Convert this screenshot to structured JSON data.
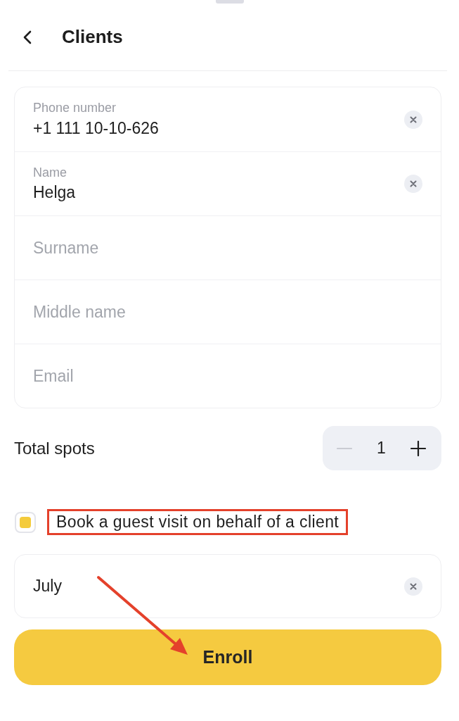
{
  "header": {
    "title": "Clients"
  },
  "form_fields": [
    {
      "label": "Phone number",
      "value": "+1 111 10-10-626"
    },
    {
      "label": "Name",
      "value": "Helga"
    },
    {
      "placeholder": "Surname"
    },
    {
      "placeholder": "Middle name"
    },
    {
      "placeholder": "Email"
    }
  ],
  "total_spots": {
    "label": "Total spots",
    "value": "1",
    "decrease_disabled": true
  },
  "guest_visit": {
    "label": "Book a guest visit on behalf of a client",
    "checked": true,
    "highlighted": true
  },
  "guest_field": {
    "value": "July"
  },
  "enroll_button": {
    "label": "Enroll"
  }
}
